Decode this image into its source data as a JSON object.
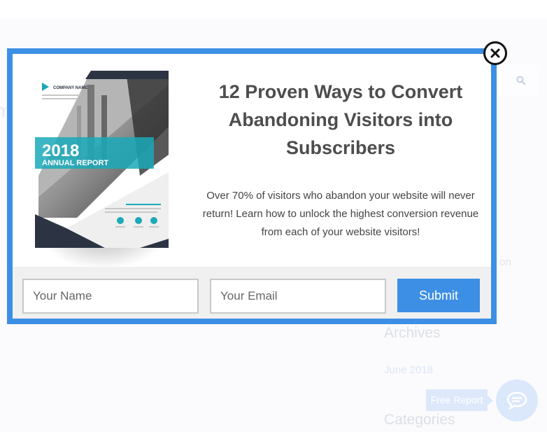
{
  "popup": {
    "headline": "12 Proven Ways to Convert Abandoning Visitors into Subscribers",
    "description": "Over 70% of visitors who abandon your website will never return! Learn how to unlock the highest conversion revenue from each of your website visitors!",
    "cover": {
      "company_name": "COMPANY NAME",
      "year": "2018",
      "subtitle": "ANNUAL REPORT"
    },
    "form": {
      "name_placeholder": "Your Name",
      "email_placeholder": "Your Email",
      "submit_label": "Submit"
    },
    "close_icon": "close-x-icon"
  },
  "background": {
    "sidebar_fragment_1": "s",
    "sidebar_fragment_2": "r on",
    "archives_heading": "Archives",
    "archive_link": "June 2018",
    "categories_heading": "Categories",
    "free_report_label": "Free Report",
    "chat_icon": "chat-icon",
    "search_icon": "search-icon"
  },
  "colors": {
    "accent": "#3d8fe5",
    "headline": "#4d4d4d",
    "cover_dark": "#2c3444",
    "cover_teal": "#1aa9b8"
  }
}
